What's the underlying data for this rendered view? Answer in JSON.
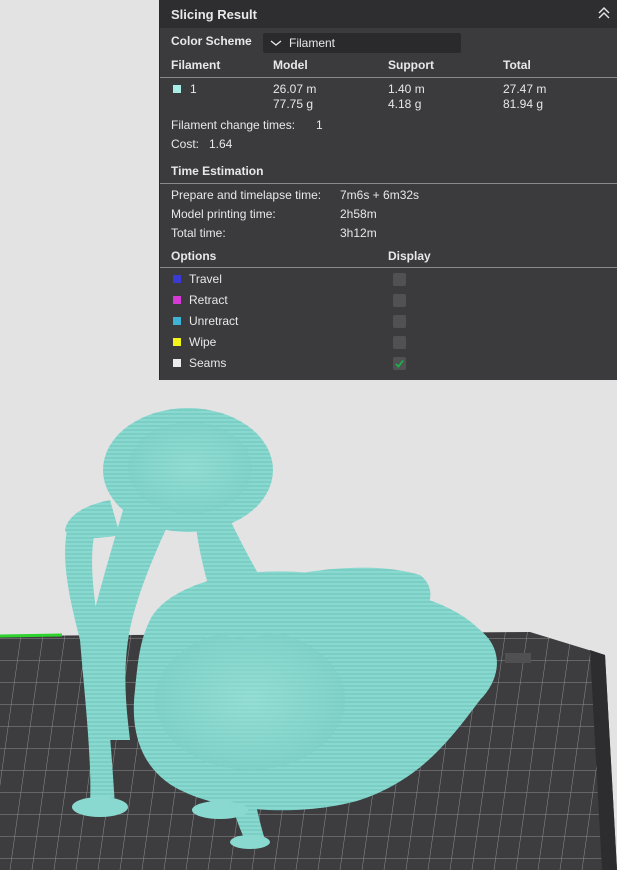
{
  "panel": {
    "title": "Slicing Result",
    "color_scheme": {
      "label": "Color Scheme",
      "value": "Filament"
    },
    "filament_table": {
      "headers": {
        "filament": "Filament",
        "model": "Model",
        "support": "Support",
        "total": "Total"
      },
      "rows": [
        {
          "id": "1",
          "color": "#a8ece6",
          "model_length": "26.07 m",
          "model_weight": "77.75 g",
          "support_length": "1.40 m",
          "support_weight": "4.18 g",
          "total_length": "27.47 m",
          "total_weight": "81.94 g"
        }
      ]
    },
    "filament_change": {
      "label": "Filament change times:",
      "value": "1"
    },
    "cost": {
      "label": "Cost:",
      "value": "1.64"
    },
    "time_estimation": {
      "title": "Time Estimation",
      "prepare": {
        "label": "Prepare and timelapse time:",
        "value": "7m6s + 6m32s"
      },
      "model": {
        "label": "Model printing time:",
        "value": "2h58m"
      },
      "total": {
        "label": "Total time:",
        "value": "3h12m"
      }
    },
    "options": {
      "header": "Options",
      "display_header": "Display",
      "items": [
        {
          "label": "Travel",
          "color": "#3a3ad6",
          "checked": false
        },
        {
          "label": "Retract",
          "color": "#d639d6",
          "checked": false
        },
        {
          "label": "Unretract",
          "color": "#3fb3d6",
          "checked": false
        },
        {
          "label": "Wipe",
          "color": "#f4f41a",
          "checked": false
        },
        {
          "label": "Seams",
          "color": "#ececec",
          "checked": true
        }
      ]
    }
  },
  "viewport": {
    "model_color": "#88d8cf",
    "plate_color": "#3d3d3f",
    "background_color": "#e3e3e3"
  }
}
